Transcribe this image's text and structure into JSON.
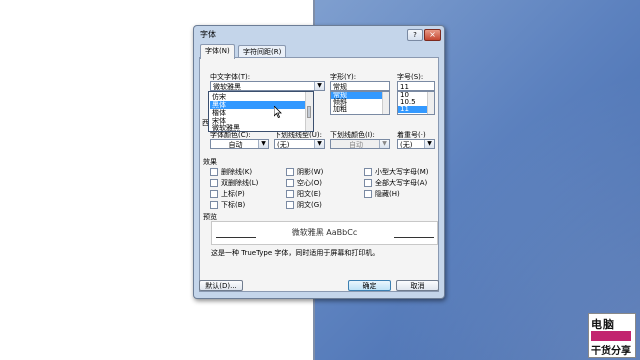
{
  "dialog": {
    "title": "字体",
    "help_glyph": "?",
    "close_glyph": "×"
  },
  "tabs": [
    {
      "label": "字体(N)",
      "active": true
    },
    {
      "label": "字符间距(R)",
      "active": false
    }
  ],
  "font_cn": {
    "label": "中文字体(T):",
    "value": "微软雅黑",
    "options": [
      "仿宋",
      "黑体",
      "楷体",
      "宋体",
      "微软雅黑"
    ],
    "highlighted_index": 1
  },
  "style": {
    "label": "字形(Y):",
    "value": "常规",
    "options": [
      "常规",
      "倾斜",
      "加粗"
    ],
    "selected_index": 0
  },
  "size": {
    "label": "字号(S):",
    "value": "11",
    "options": [
      "10",
      "10.5",
      "11"
    ],
    "selected_index": 2
  },
  "west_label_fragment": "西",
  "row_labels": {
    "font_color": "字体颜色(C):",
    "underline": "下划线线型(U):",
    "underline_color": "下划线颜色(I):",
    "emphasis": "着重号(·)"
  },
  "row_values": {
    "font_color": "自动",
    "underline": "(无)",
    "underline_color": "自动",
    "emphasis": "(无)"
  },
  "effects": {
    "title": "效果",
    "items": [
      "删除线(K)",
      "阴影(W)",
      "小型大写字母(M)",
      "双删除线(L)",
      "空心(O)",
      "全部大写字母(A)",
      "上标(P)",
      "阳文(E)",
      "隐藏(H)",
      "下标(B)",
      "阴文(G)"
    ]
  },
  "preview": {
    "title": "预览",
    "sample": "微软雅黑  AaBbCc",
    "note": "这是一种 TrueType 字体，同时适用于屏幕和打印机。"
  },
  "buttons": {
    "default": "默认(D)...",
    "ok": "确定",
    "cancel": "取消"
  },
  "logo": {
    "top": "电脑",
    "bottom": "干货分享"
  },
  "colors": {
    "selection": "#3399ff",
    "dialog_bg": "#c4d5ea",
    "logo_accent": "#c2246f"
  }
}
